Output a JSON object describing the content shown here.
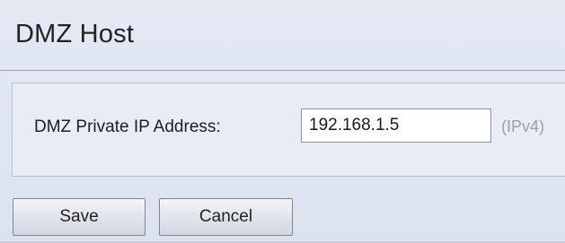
{
  "page": {
    "title": "DMZ Host"
  },
  "form": {
    "ip_label": "DMZ Private IP Address:",
    "ip_value": "192.168.1.5",
    "ip_hint": "(IPv4)"
  },
  "actions": {
    "save_label": "Save",
    "cancel_label": "Cancel"
  }
}
